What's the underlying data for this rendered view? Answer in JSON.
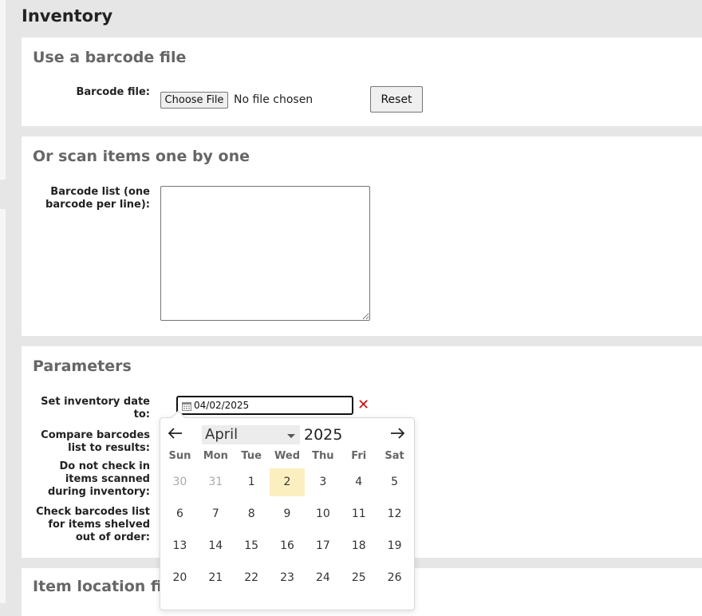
{
  "page": {
    "title": "Inventory"
  },
  "barcode_file_section": {
    "title": "Use a barcode file",
    "label": "Barcode file:",
    "choose_button": "Choose File",
    "no_file_text": "No file chosen",
    "reset_button": "Reset"
  },
  "scan_section": {
    "title": "Or scan items one by one",
    "label_line1": "Barcode list (one",
    "label_line2": "barcode per line):",
    "textarea_value": ""
  },
  "parameters_section": {
    "title": "Parameters",
    "date_label_line1": "Set inventory date",
    "date_label_line2": "to:",
    "date_value": "04/02/2025",
    "compare_label_line1": "Compare barcodes",
    "compare_label_line2": "list to results:",
    "no_checkin_line1": "Do not check in",
    "no_checkin_line2": "items scanned",
    "no_checkin_line3": "during inventory:",
    "order_line1": "Check barcodes list",
    "order_line2": "for items shelved",
    "order_line3": "out of order:"
  },
  "item_location_section": {
    "title": "Item location filters"
  },
  "datepicker": {
    "month": "April",
    "year": "2025",
    "prev_icon": "arrow-left-icon",
    "next_icon": "arrow-right-icon",
    "weekdays": [
      "Sun",
      "Mon",
      "Tue",
      "Wed",
      "Thu",
      "Fri",
      "Sat"
    ],
    "weeks": [
      [
        "30",
        "31",
        "1",
        "2",
        "3",
        "4",
        "5"
      ],
      [
        "6",
        "7",
        "8",
        "9",
        "10",
        "11",
        "12"
      ],
      [
        "13",
        "14",
        "15",
        "16",
        "17",
        "18",
        "19"
      ],
      [
        "20",
        "21",
        "22",
        "23",
        "24",
        "25",
        "26"
      ]
    ],
    "today": "2",
    "highlight_color": "#fcefbf"
  },
  "colors": {
    "clear_icon": "#cc1111",
    "section_title": "#666666"
  }
}
